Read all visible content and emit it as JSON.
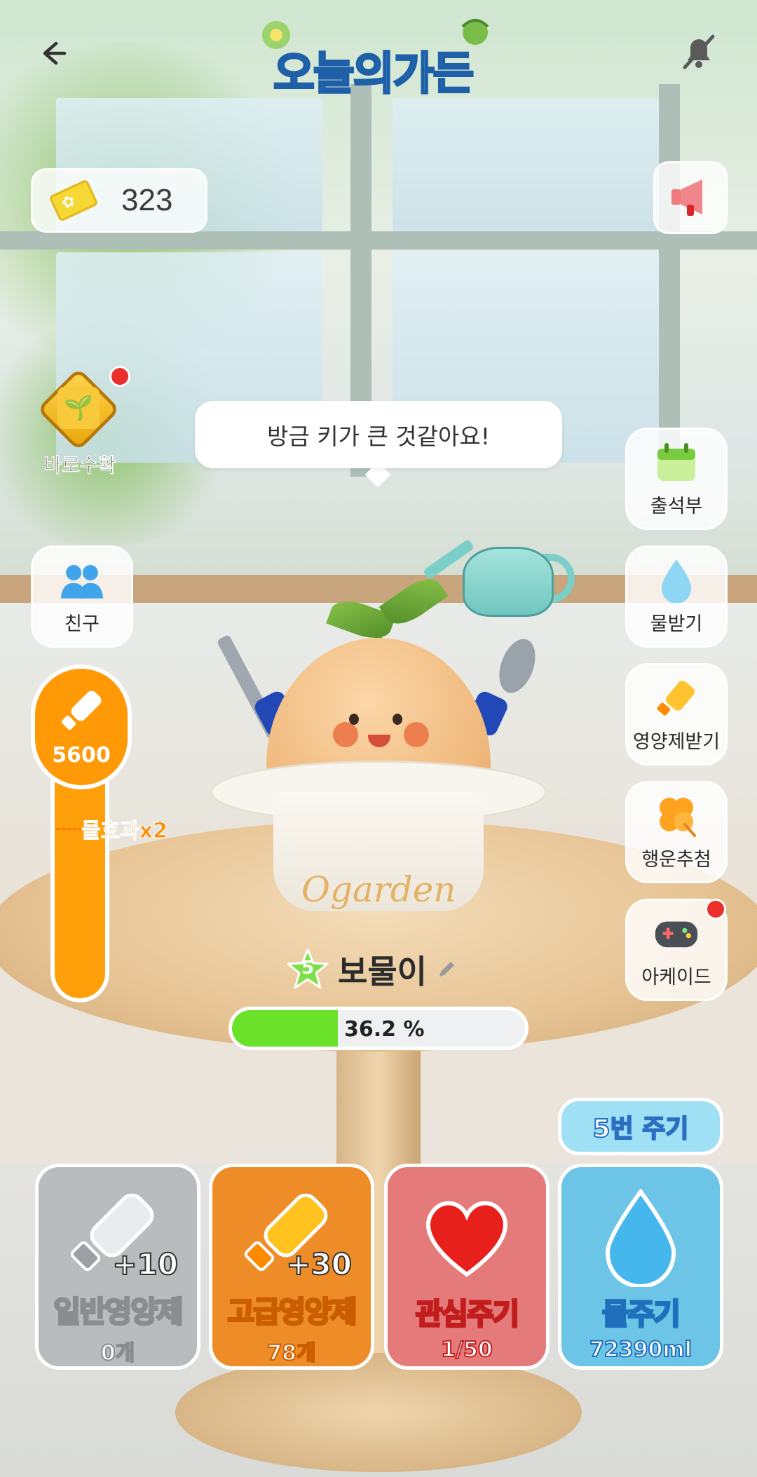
{
  "header": {
    "logo_text": "오늘의가든",
    "back_icon": "arrow-left-icon",
    "notification_icon": "bell-off-icon"
  },
  "currency": {
    "ticket_count": "323"
  },
  "harvest": {
    "label": "바로수확",
    "has_alert": true
  },
  "speech": "방금 키가 큰 것같아요!",
  "left_menu": [
    {
      "id": "friends",
      "label": "친구",
      "icon": "friends-icon"
    }
  ],
  "right_menu": [
    {
      "id": "attendance",
      "label": "출석부",
      "icon": "calendar-icon"
    },
    {
      "id": "get-water",
      "label": "물받기",
      "icon": "water-drop-icon"
    },
    {
      "id": "get-nutrient",
      "label": "영양제받기",
      "icon": "nutrient-bottle-icon"
    },
    {
      "id": "lucky-draw",
      "label": "행운추첨",
      "icon": "clover-icon"
    },
    {
      "id": "arcade",
      "label": "아케이드",
      "icon": "gamepad-icon",
      "has_alert": true
    }
  ],
  "water_gauge": {
    "value": "5600",
    "boost_label": "물효과x2"
  },
  "pet": {
    "level": "5",
    "name": "보물이",
    "pot_text": "Ogarden",
    "growth_percent": 36.2,
    "growth_label": "36.2 %"
  },
  "multi_give": {
    "label": "5번 주기"
  },
  "actions": [
    {
      "id": "normal-nutrient",
      "title": "일반영양제",
      "sub": "0개",
      "plus": "+10",
      "bg": "#b9bcbf",
      "stroke": "#8a8d90"
    },
    {
      "id": "premium-nutrient",
      "title": "고급영양제",
      "sub": "78개",
      "plus": "+30",
      "bg": "#ee8d28",
      "stroke": "#c95d00"
    },
    {
      "id": "give-attention",
      "title": "관심주기",
      "sub": "1/50",
      "bg": "#e57a7a",
      "stroke": "#c21d1d"
    },
    {
      "id": "give-water",
      "title": "물주기",
      "sub": "72390ml",
      "bg": "#6cc5e6",
      "stroke": "#1f6fbd"
    }
  ],
  "colors": {
    "gauge": "#ff9a06",
    "progress_fill": "#6be22a",
    "alert": "#e9302a"
  }
}
